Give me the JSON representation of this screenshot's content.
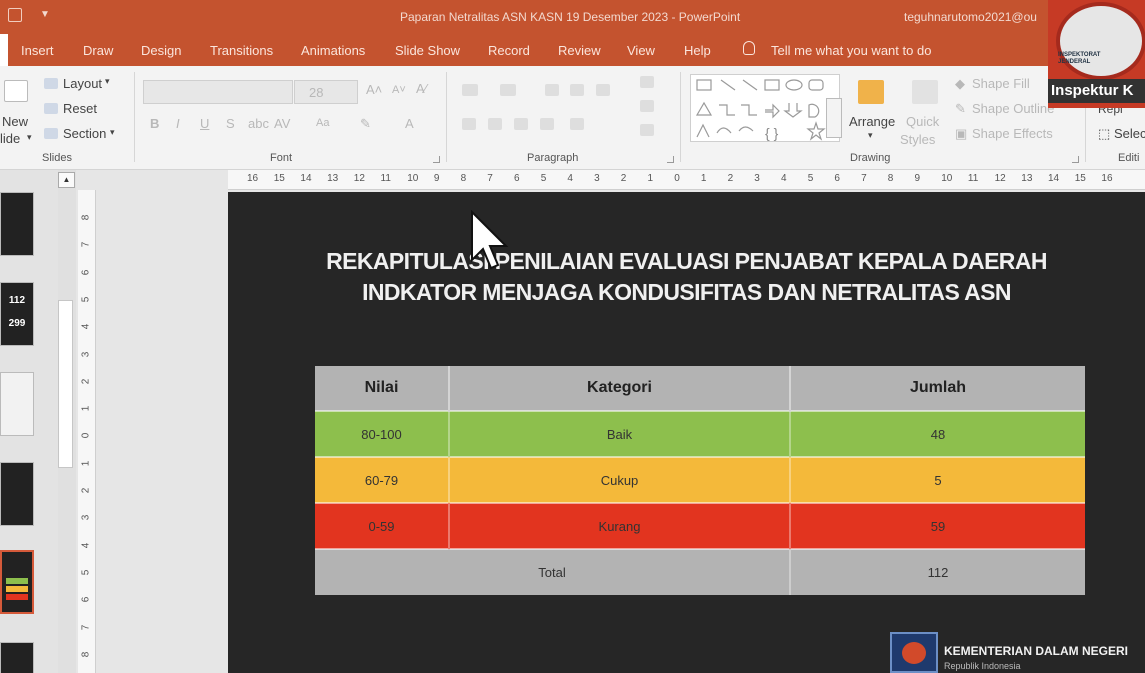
{
  "window": {
    "title": "Paparan Netralitas ASN KASN 19 Desember 2023  -  PowerPoint",
    "account": "teguhnarutomo2021@ou"
  },
  "tabs": [
    "Insert",
    "Draw",
    "Design",
    "Transitions",
    "Animations",
    "Slide Show",
    "Record",
    "Review",
    "View",
    "Help"
  ],
  "tell_me": "Tell me what you want to do",
  "ribbon": {
    "slides": {
      "new_slide_1": "New",
      "new_slide_2": "lide",
      "layout": "Layout",
      "reset": "Reset",
      "section": "Section",
      "label": "Slides"
    },
    "font": {
      "size": "28",
      "label": "Font",
      "bold": "B",
      "italic": "I",
      "underline": "U",
      "strike": "S",
      "aa": "Aa",
      "a_color": "A"
    },
    "paragraph": {
      "label": "Paragraph"
    },
    "drawing": {
      "arrange": "Arrange",
      "quick_styles_1": "Quick",
      "quick_styles_2": "Styles",
      "shape_fill": "Shape Fill",
      "shape_outline": "Shape Outline",
      "shape_effects": "Shape Effects",
      "label": "Drawing"
    },
    "editing": {
      "select": "Selec",
      "label": "Editi",
      "replace": "Repl"
    }
  },
  "ruler": {
    "h": [
      "16",
      "15",
      "14",
      "13",
      "12",
      "11",
      "10",
      "9",
      "8",
      "7",
      "6",
      "5",
      "4",
      "3",
      "2",
      "1",
      "0",
      "1",
      "2",
      "3",
      "4",
      "5",
      "6",
      "7",
      "8",
      "9",
      "10",
      "11",
      "12",
      "13",
      "14",
      "15",
      "16"
    ],
    "v": [
      "8",
      "7",
      "6",
      "5",
      "4",
      "3",
      "2",
      "1",
      "0",
      "1",
      "2",
      "3",
      "4",
      "5",
      "6",
      "7",
      "8"
    ]
  },
  "thumbnails": {
    "t2_a": "112",
    "t2_b": "299"
  },
  "slide": {
    "title_line1": "REKAPITULASI PENILAIAN EVALUASI PENJABAT KEPALA DAERAH",
    "title_line2": "INDKATOR MENJAGA KONDUSIFITAS DAN NETRALITAS ASN",
    "table": {
      "headers": [
        "Nilai",
        "Kategori",
        "Jumlah"
      ],
      "rows": [
        {
          "nilai": "80-100",
          "kategori": "Baik",
          "jumlah": "48",
          "color": "#8dbf4d"
        },
        {
          "nilai": "60-79",
          "kategori": "Cukup",
          "jumlah": "5",
          "color": "#f4b93a"
        },
        {
          "nilai": "0-59",
          "kategori": "Kurang",
          "jumlah": "59",
          "color": "#e2341f"
        }
      ],
      "total": {
        "label": "Total",
        "value": "112",
        "color": "#b3b3b3"
      }
    },
    "logo": {
      "name": "KEMENTERIAN DALAM NEGERI",
      "sub": "Republik Indonesia"
    }
  },
  "webcam": {
    "badge_1": "INSPEKTORAT",
    "badge_2": "JENDERAL",
    "name": "Inspektur K"
  },
  "colors": {
    "accent": "#c4532f",
    "slide_bg": "#262626"
  }
}
